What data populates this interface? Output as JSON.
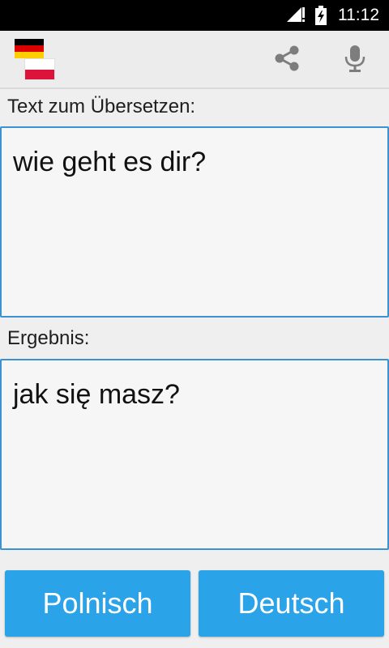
{
  "status_bar": {
    "time": "11:12",
    "icons": [
      "signal-icon",
      "no-sim-icon",
      "battery-charging-icon"
    ]
  },
  "toolbar": {
    "flags": {
      "source": "german-flag-icon",
      "target": "polish-flag-icon"
    },
    "actions": [
      "share-icon",
      "microphone-icon"
    ]
  },
  "source": {
    "label": "Text zum Übersetzen:",
    "text": "wie geht es dir?"
  },
  "result": {
    "label": "Ergebnis:",
    "text": "jak się masz?"
  },
  "buttons": {
    "left": "Polnisch",
    "right": "Deutsch"
  },
  "colors": {
    "accent": "#2ba3e8",
    "border": "#3a92d2",
    "status_bar": "#000000",
    "toolbar": "#ececec"
  }
}
